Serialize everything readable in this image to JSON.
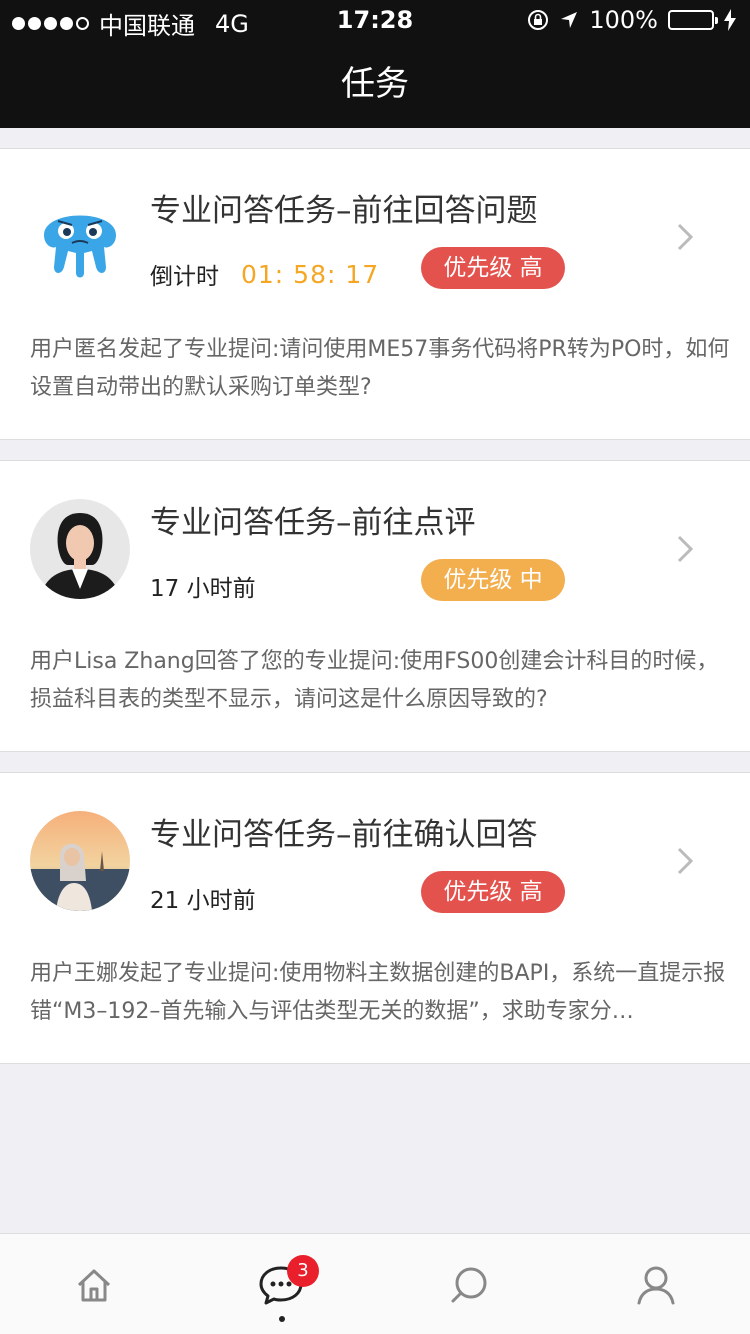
{
  "status_bar": {
    "carrier": "中国联通",
    "network": "4G",
    "time": "17:28",
    "battery": "100%"
  },
  "nav": {
    "title": "任务"
  },
  "tasks": [
    {
      "title": "专业问答任务–前往回答问题",
      "meta_label": "倒计时",
      "countdown": "01: 58: 17",
      "priority": "优先级 高",
      "description": "用户匿名发起了专业提问:请问使用ME57事务代码将PR转为PO时，如何设置自动带出的默认采购订单类型?"
    },
    {
      "title": "专业问答任务–前往点评",
      "meta_label": "17 小时前",
      "priority": "优先级 中",
      "description": "用户Lisa Zhang回答了您的专业提问:使用FS00创建会计科目的时候，损益科目表的类型不显示，请问这是什么原因导致的?"
    },
    {
      "title": "专业问答任务–前往确认回答",
      "meta_label": "21 小时前",
      "priority": "优先级 高",
      "description": "用户王娜发起了专业提问:使用物料主数据创建的BAPI，系统一直提示报错“M3–192–首先输入与评估类型无关的数据”，求助专家分…"
    }
  ],
  "tab_bar": {
    "tabs": [
      "home-icon",
      "message-icon",
      "discover-icon",
      "profile-icon"
    ],
    "unread_count": "3"
  },
  "colors": {
    "priority_high": "#e4524d",
    "priority_mid": "#f3ae4e",
    "countdown": "#f5a623"
  }
}
